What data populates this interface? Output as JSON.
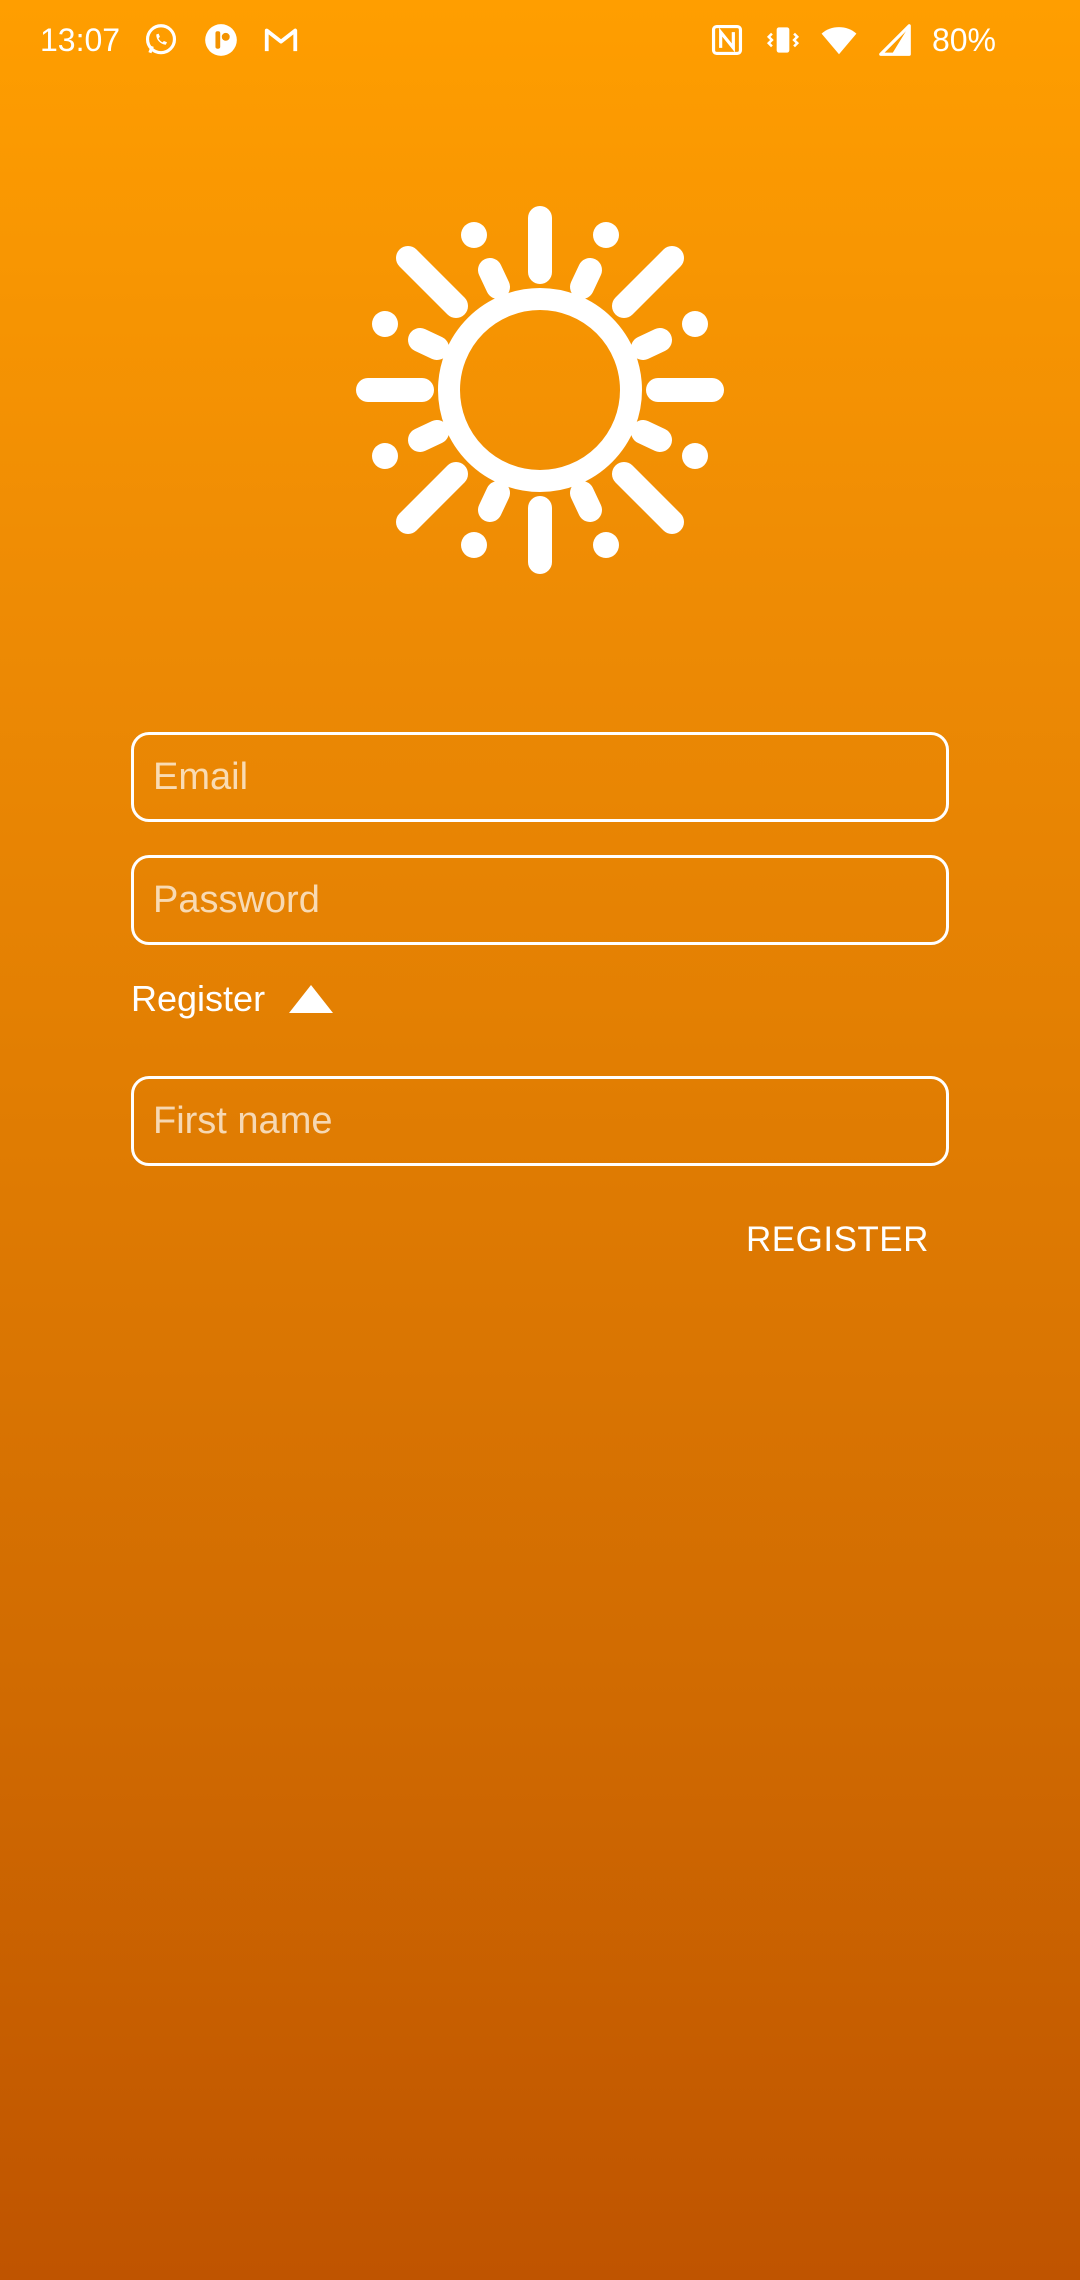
{
  "status_bar": {
    "time": "13:07",
    "battery": "80%",
    "left_icons": [
      "whatsapp-icon",
      "app-icon",
      "gmail-icon"
    ],
    "right_icons": [
      "nfc-icon",
      "vibrate-icon",
      "wifi-icon",
      "signal-icon"
    ]
  },
  "logo": {
    "icon": "sun-icon"
  },
  "form": {
    "email_placeholder": "Email",
    "password_placeholder": "Password",
    "register_toggle_label": "Register",
    "register_toggle_icon": "triangle-up-icon",
    "first_name_placeholder": "First name",
    "register_button_label": "REGISTER"
  },
  "colors": {
    "gradient_top": "#ff9e00",
    "gradient_bottom": "#bf5400",
    "foreground": "#ffffff"
  }
}
